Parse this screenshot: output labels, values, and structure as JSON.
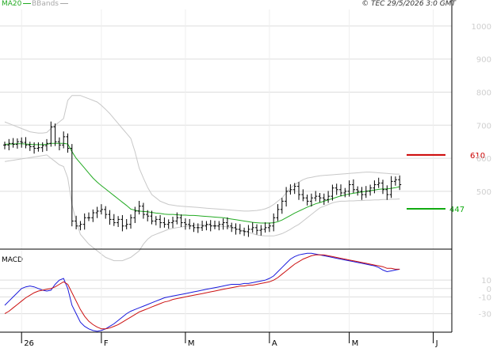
{
  "header": {
    "ma20_label": "MA20",
    "bbands_label": "BBands",
    "copyright": "© TEC 29/5/2026 3:0 GMT"
  },
  "colors": {
    "ma20": "#22aa22",
    "bbands": "#c8c8c8",
    "price_bar": "#000000",
    "macd": "#1a1adc",
    "signal": "#cc1111",
    "resistance": "#cc0000",
    "support": "#11aa11",
    "grid": "#dddddd"
  },
  "chart_data": [
    {
      "type": "ohlc",
      "title": "",
      "x_ticks": [
        "26",
        "F",
        "M",
        "A",
        "M",
        "J"
      ],
      "x_tick_index": [
        4,
        23,
        43,
        63,
        82,
        102
      ],
      "y_ticks": [
        500,
        600,
        700,
        800,
        900,
        1000
      ],
      "ylim": [
        325,
        1050
      ],
      "grid": true,
      "legend": [
        "MA20",
        "BBands"
      ],
      "legend_position": "top-left",
      "levels": [
        {
          "value": 610,
          "label": "610",
          "color": "#cc0000",
          "side": "above-left"
        },
        {
          "value": 447,
          "label": "447",
          "color": "#11aa11",
          "side": "right"
        }
      ],
      "series": [
        {
          "name": "Price",
          "role": "price",
          "values": [
            640,
            645,
            642,
            650,
            648,
            640,
            635,
            630,
            632,
            638,
            645,
            695,
            650,
            640,
            665,
            630,
            410,
            395,
            400,
            420,
            420,
            435,
            440,
            445,
            430,
            415,
            405,
            415,
            395,
            400,
            420,
            440,
            455,
            430,
            425,
            410,
            415,
            405,
            400,
            405,
            410,
            420,
            405,
            400,
            395,
            390,
            390,
            395,
            400,
            395,
            395,
            400,
            405,
            395,
            390,
            385,
            380,
            378,
            385,
            390,
            382,
            385,
            390,
            395,
            420,
            445,
            470,
            500,
            505,
            515,
            490,
            480,
            470,
            480,
            485,
            480,
            475,
            485,
            510,
            505,
            495,
            500,
            520,
            505,
            500,
            490,
            500,
            510,
            520,
            525,
            505,
            490,
            530,
            535,
            520
          ]
        },
        {
          "name": "MA20",
          "role": "ma",
          "values": [
            642,
            643,
            643,
            644,
            644,
            643,
            642,
            641,
            641,
            641,
            642,
            645,
            645,
            645,
            645,
            643,
            620,
            600,
            585,
            570,
            555,
            540,
            528,
            517,
            507,
            497,
            487,
            477,
            467,
            457,
            446,
            443,
            440,
            439,
            438,
            436,
            434,
            433,
            431,
            430,
            430,
            429,
            428,
            428,
            427,
            427,
            426,
            425,
            424,
            423,
            422,
            421,
            420,
            418,
            416,
            414,
            412,
            410,
            408,
            406,
            405,
            404,
            404,
            404,
            405,
            408,
            413,
            420,
            427,
            434,
            440,
            446,
            452,
            457,
            462,
            466,
            470,
            474,
            478,
            482,
            486,
            489,
            492,
            494,
            496,
            498,
            500,
            502,
            504,
            506,
            507,
            507,
            509,
            511,
            514
          ]
        },
        {
          "name": "BBands Upper",
          "role": "band",
          "values": [
            710,
            705,
            700,
            695,
            690,
            685,
            680,
            678,
            676,
            676,
            678,
            690,
            700,
            710,
            720,
            775,
            790,
            790,
            790,
            785,
            780,
            775,
            770,
            760,
            748,
            735,
            720,
            705,
            690,
            675,
            660,
            620,
            570,
            540,
            512,
            490,
            480,
            470,
            465,
            460,
            458,
            456,
            455,
            454,
            453,
            452,
            451,
            450,
            449,
            448,
            447,
            446,
            445,
            444,
            443,
            442,
            441,
            440,
            440,
            441,
            442,
            444,
            447,
            452,
            460,
            470,
            480,
            495,
            510,
            520,
            528,
            535,
            540,
            542,
            545,
            547,
            548,
            549,
            550,
            551,
            552,
            553,
            554,
            555,
            556,
            557,
            558,
            558,
            557,
            556,
            555,
            554,
            553,
            552,
            552
          ]
        },
        {
          "name": "BBands Lower",
          "role": "band",
          "values": [
            590,
            592,
            594,
            596,
            598,
            600,
            602,
            604,
            606,
            608,
            610,
            600,
            590,
            580,
            575,
            540,
            460,
            410,
            370,
            355,
            340,
            330,
            320,
            310,
            300,
            295,
            290,
            290,
            290,
            295,
            300,
            310,
            320,
            340,
            355,
            365,
            370,
            375,
            380,
            385,
            388,
            390,
            392,
            394,
            396,
            398,
            398,
            398,
            398,
            397,
            396,
            395,
            394,
            392,
            390,
            387,
            383,
            380,
            376,
            372,
            368,
            366,
            365,
            365,
            365,
            368,
            372,
            378,
            385,
            393,
            400,
            410,
            420,
            430,
            440,
            450,
            455,
            460,
            465,
            468,
            470,
            470,
            471,
            471,
            472,
            472,
            473,
            473,
            474,
            474,
            475,
            475,
            476,
            476,
            477
          ]
        }
      ]
    },
    {
      "type": "line",
      "title": "MACD",
      "y_ticks": [
        10,
        0,
        -10,
        -30
      ],
      "y_tick_labels": [
        "10",
        "0",
        "-10",
        "-30"
      ],
      "ylim": [
        -52,
        45
      ],
      "grid": true,
      "series": [
        {
          "name": "MACD",
          "role": "macd",
          "values": [
            -20,
            -15,
            -10,
            -5,
            0,
            2,
            3,
            2,
            0,
            -2,
            -3,
            -2,
            5,
            10,
            12,
            0,
            -20,
            -30,
            -40,
            -45,
            -48,
            -50,
            -51,
            -50,
            -48,
            -45,
            -42,
            -38,
            -34,
            -30,
            -27,
            -25,
            -23,
            -21,
            -19,
            -17,
            -15,
            -13,
            -11,
            -10,
            -9,
            -8,
            -7,
            -6,
            -5,
            -4,
            -3,
            -2,
            -1,
            0,
            1,
            2,
            3,
            4,
            5,
            5,
            5,
            6,
            6,
            7,
            8,
            9,
            10,
            12,
            15,
            20,
            25,
            30,
            35,
            38,
            40,
            41,
            42,
            42,
            41,
            40,
            39,
            38,
            37,
            36,
            35,
            34,
            33,
            32,
            31,
            30,
            29,
            28,
            27,
            25,
            22,
            20,
            21,
            22,
            23
          ]
        },
        {
          "name": "Signal",
          "role": "signal",
          "values": [
            -30,
            -27,
            -23,
            -19,
            -15,
            -11,
            -8,
            -5,
            -3,
            -2,
            -1,
            0,
            2,
            5,
            8,
            5,
            -5,
            -15,
            -25,
            -33,
            -39,
            -43,
            -46,
            -48,
            -48,
            -47,
            -45,
            -43,
            -40,
            -37,
            -34,
            -31,
            -28,
            -26,
            -24,
            -22,
            -20,
            -18,
            -16,
            -15,
            -13,
            -12,
            -11,
            -10,
            -9,
            -8,
            -7,
            -6,
            -5,
            -4,
            -3,
            -2,
            -1,
            0,
            1,
            2,
            3,
            3,
            4,
            4,
            5,
            6,
            7,
            8,
            10,
            13,
            17,
            21,
            25,
            29,
            32,
            35,
            37,
            39,
            40,
            40,
            40,
            39,
            38,
            37,
            36,
            35,
            34,
            33,
            32,
            31,
            30,
            29,
            28,
            27,
            26,
            24,
            24,
            23,
            23
          ]
        }
      ]
    }
  ]
}
